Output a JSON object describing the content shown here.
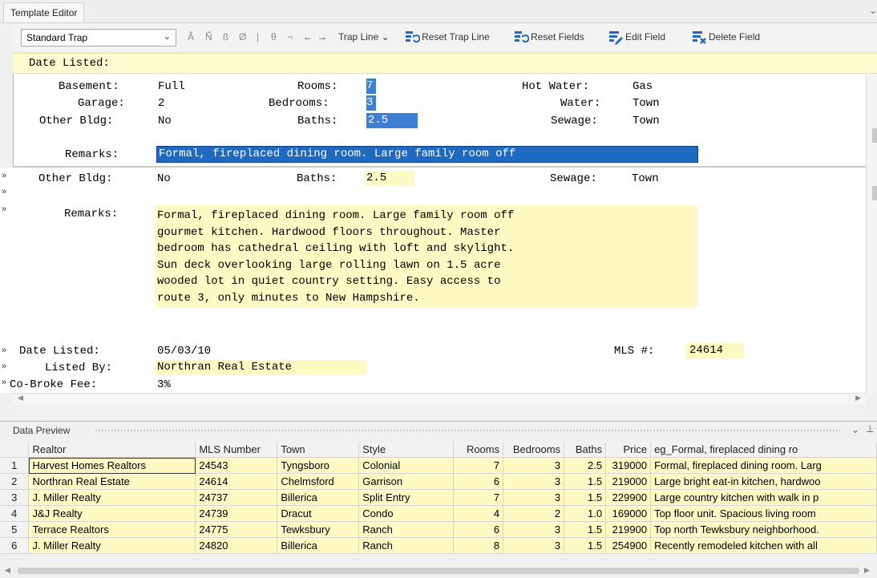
{
  "window": {
    "tab_title": "Template Editor"
  },
  "toolbar": {
    "trap_select": "Standard Trap",
    "glyphs": [
      "Ã",
      "Ñ",
      "ß",
      "Ø",
      "|",
      "θ",
      "¬",
      "←",
      "→"
    ],
    "trap_line": "Trap Line",
    "reset_trap_line": "Reset Trap Line",
    "reset_fields": "Reset Fields",
    "edit_field": "Edit Field",
    "delete_field": "Delete Field"
  },
  "date_bar": {
    "text": "Date Listed:"
  },
  "editor_top": {
    "basement_label": "Basement:",
    "basement_value": "Full",
    "garage_label": "Garage:",
    "garage_value": "2",
    "other_label": "Other Bldg:",
    "other_value": "No",
    "rooms_label": "Rooms:",
    "rooms_value": "7",
    "bedrooms_label": "Bedrooms:",
    "bedrooms_value": "3",
    "baths_label": "Baths:",
    "baths_value": "2.5",
    "hotwater_label": "Hot Water:",
    "hotwater_value": "Gas",
    "water_label": "Water:",
    "water_value": "Town",
    "sewage_label": "Sewage:",
    "sewage_value": "Town",
    "remarks_label": "Remarks:",
    "remarks_value": "Formal, fireplaced dining room.  Large family room off"
  },
  "editor_bottom": {
    "other_label": "Other Bldg:",
    "other_value": "No",
    "baths_label": "Baths:",
    "baths_value": "2.5",
    "sewage_label": "Sewage:",
    "sewage_value": "Town",
    "remarks_label": "Remarks:",
    "remarks_lines": [
      "Formal, fireplaced dining room.  Large family room off",
      "gourmet kitchen.  Hardwood floors throughout.  Master",
      "bedroom has cathedral ceiling with loft and skylight.",
      "Sun deck overlooking large rolling lawn on 1.5 acre",
      "wooded lot in quiet country setting.  Easy access to",
      "route 3, only minutes to New Hampshire."
    ],
    "date_label": "Date Listed:",
    "date_value": "05/03/10",
    "mls_label": "MLS #:",
    "mls_value": "24614",
    "listed_label": "Listed By:",
    "listed_value": "Northran Real Estate",
    "cobroke_label": "Co-Broke Fee:",
    "cobroke_value": "3%",
    "marker": "»"
  },
  "data_preview": {
    "title": "Data Preview",
    "columns": [
      "Realtor",
      "MLS Number",
      "Town",
      "Style",
      "Rooms",
      "Bedrooms",
      "Baths",
      "Price",
      "eg_Formal, fireplaced dining ro"
    ],
    "rows": [
      [
        "1",
        "Harvest Homes Realtors",
        "24543",
        "Tyngsboro",
        "Colonial",
        "7",
        "3",
        "2.5",
        "319000",
        "Formal, fireplaced dining room.  Larg"
      ],
      [
        "2",
        "Northran Real Estate",
        "24614",
        "Chelmsford",
        "Garrison",
        "6",
        "3",
        "1.5",
        "219000",
        "Large bright eat-in kitchen, hardwoo"
      ],
      [
        "3",
        "J. Miller Realty",
        "24737",
        "Billerica",
        "Split Entry",
        "7",
        "3",
        "1.5",
        "229900",
        "Large country kitchen with walk in p"
      ],
      [
        "4",
        "J&J Realty",
        "24739",
        "Dracut",
        "Condo",
        "4",
        "2",
        "1.0",
        "169000",
        "Top floor unit.  Spacious living room"
      ],
      [
        "5",
        "Terrace Realtors",
        "24775",
        "Tewksbury",
        "Ranch",
        "6",
        "3",
        "1.5",
        "219900",
        "Top north Tewksbury neighborhood."
      ],
      [
        "6",
        "J. Miller Realty",
        "24820",
        "Billerica",
        "Ranch",
        "8",
        "3",
        "1.5",
        "254900",
        "Recently remodeled kitchen with all"
      ]
    ]
  },
  "colors": {
    "highlight": "#3d7fd3",
    "field_yellow": "#fff9c4",
    "icon_blue": "#1e6ac2"
  }
}
